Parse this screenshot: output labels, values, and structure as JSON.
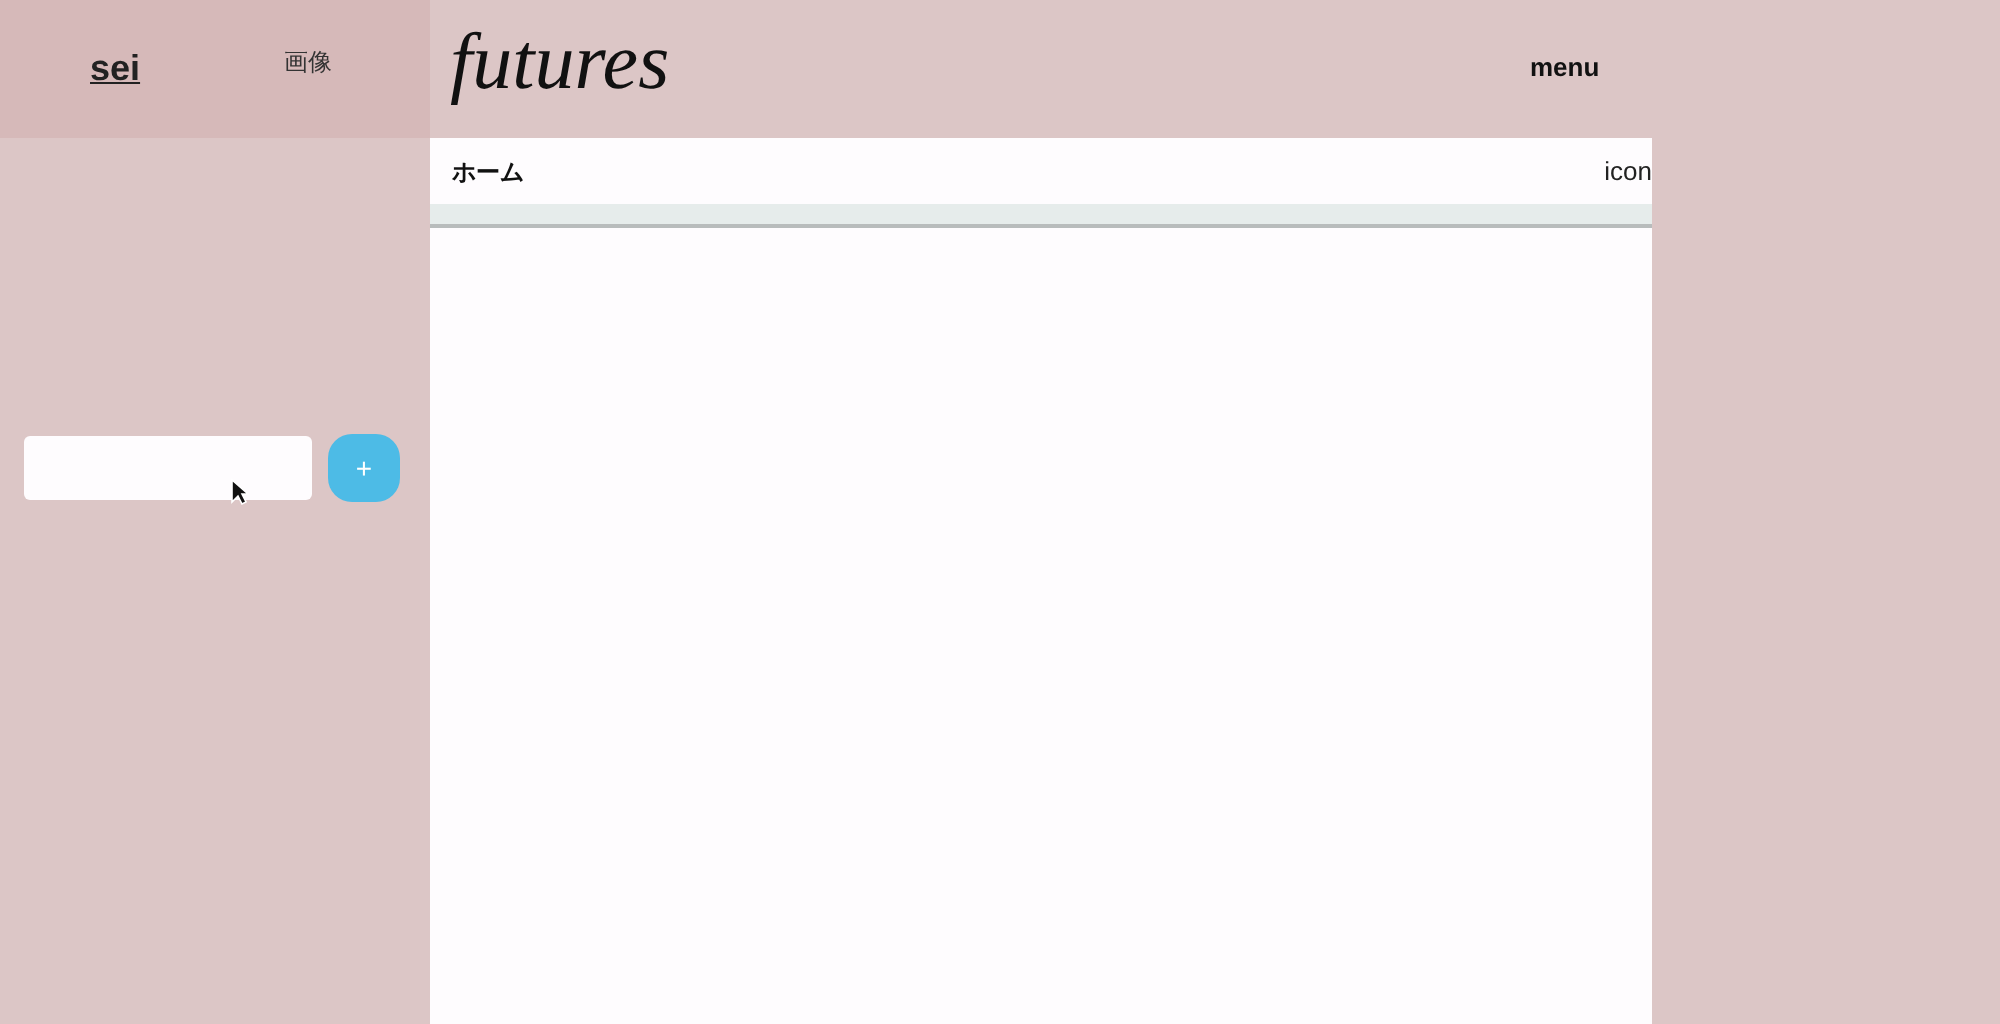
{
  "sidebar_header": {
    "user_link": "sei",
    "image_label": "画像"
  },
  "logo": "futures",
  "nav": {
    "menu": "menu"
  },
  "tab_bar": {
    "title": "ホーム",
    "icon_label": "icon"
  },
  "add_form": {
    "button": "+"
  }
}
